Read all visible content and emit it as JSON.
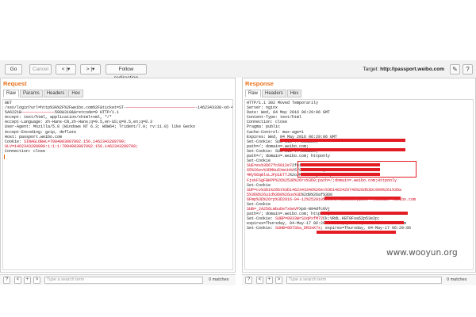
{
  "toolbar": {
    "go": "Go",
    "cancel": "Cancel",
    "back": "< |▾",
    "forward": "> |▾",
    "follow": "Follow redirection",
    "target_label": "Target:",
    "target_value": "http://passport.weibo.com"
  },
  "request": {
    "title": "Request",
    "tabs": [
      "Raw",
      "Params",
      "Headers",
      "Hex"
    ],
    "lines": [
      {
        "t": "GET",
        "red": ""
      },
      {
        "t": "/sso/login?url=http%3A%2F%2Fweibo.com%2F&ticket=ST-",
        "red": "—————————————————————————————",
        "tail": "-1462343338-xd-465642B"
      },
      {
        "t": "5A6221B",
        "red": "——————————————",
        "tail": "580&318&&retcode=0 HTTP/1.1"
      },
      {
        "t": "Accept: text/html, application/xhtml+xml, */*",
        "red": ""
      },
      {
        "t": "Accept-Language: zh-Hans-CN,zh-Hans;q=0.5,en-US;q=0.5,en;q=0.3",
        "red": ""
      },
      {
        "t": "User-Agent: Mozilla/5.0 (Windows NT 6.3; WOW64; Trident/7.0; rv:11.0) like Gecko",
        "red": ""
      },
      {
        "t": "Accept-Encoding: gzip, deflate",
        "red": ""
      },
      {
        "t": "Host: passport.weibo.com",
        "red": ""
      },
      {
        "t": "Cookie: ",
        "red": "SINAGLOBAL=7004083087092.156.1462343289799;"
      },
      {
        "t": "",
        "red": "ULV=1462343289800:1:1:1:7004083087092.156.1462343289799;"
      },
      {
        "t": "Connection: close",
        "red": ""
      }
    ]
  },
  "response": {
    "title": "Response",
    "tabs": [
      "Raw",
      "Headers",
      "Hex"
    ],
    "lines": [
      {
        "t": "HTTP/1.1 302 Moved Temporarily",
        "red": ""
      },
      {
        "t": "Server: nginx",
        "red": ""
      },
      {
        "t": "Date: Wed, 04 May 2016 06:29:06 GMT",
        "red": ""
      },
      {
        "t": "Content-Type: text/html",
        "red": ""
      },
      {
        "t": "Connection: close",
        "red": ""
      },
      {
        "t": "Pragma: public",
        "red": ""
      },
      {
        "t": "Cache-Control: max-age=1",
        "red": ""
      },
      {
        "t": "Expires: Wed, 04 May 2016 06:29:06 GMT",
        "red": ""
      },
      {
        "t": "Set-Cookie: SUS=SID-",
        "red": "",
        "tail": "7f403a1bc;"
      },
      {
        "t": "path=/; domain=.weibo.com;",
        "red": ""
      },
      {
        "t": "Set-Cookie: SUS=SID-",
        "red": "",
        "tail": "7f403a1bc;"
      },
      {
        "t": "path=/; domain=.weibo.com; httponly",
        "red": ""
      },
      {
        "t": "Set-Cookie",
        "red": ""
      },
      {
        "t": "",
        "red": "SUE=es%3D67fc6812e7",
        "tail": "2fe1985419c24aa3108c9087"
      },
      {
        "t": "",
        "red": "65%26ev%3DMHu5Xm1H4A",
        "tail": "5f9sadn5e17Ry8W7E8v%2b2"
      },
      {
        "t": "",
        "red": "4Ry%6qmlsLJFp1ETTJ",
        "tail": "%2oJMuDevLfy%4Blnp5%2SX"
      },
      {
        "t": "",
        "red": "FjskFSgFBKPP%26%253D%26rv%3D0;path=/;domain=.weibo.com;Httponly",
        "tail": ""
      },
      {
        "t": "Set-Cookie",
        "red": ""
      },
      {
        "t": "",
        "red": "SUP=cv%3D1%26bt%3D1462343346%26et%3D1462429746%26d%3Dc909%26i%3Da",
        "tail": ""
      },
      {
        "t": "",
        "red": "5%3D0%26uid%3D0%26us%3D",
        "tail": "%2d0%26af%3D0"
      },
      {
        "t": "",
        "red": "6Fmp%3D%26rp%3D2016-04-12%252010%253A57%253A25;path=/;domain=.weibo.com",
        "tail": ""
      },
      {
        "t": "Set-Cookie",
        "red": ""
      },
      {
        "t": "",
        "red": "SUB=_2A256LmbuDeTxGeVP",
        "tail": "Xp8-N94dfc8Vj"
      },
      {
        "t": "path=/; domain=.weibo.com; httponly",
        "red": ""
      },
      {
        "t": "Set-Cookie: ",
        "red": "SUBP=0033WrSXqPxfM72",
        "tail": "Ck;VRdL.KBT0Fsa5Zp53e2p;"
      },
      {
        "t": "expires=Thursday, 04-May-17 06:29:06 GMT; path=/; domain=.weibo.com",
        "red": ""
      },
      {
        "t": "Set-Cookie: ",
        "red": "SUHB=0D7Sba_DR3xK7s",
        "tail": "; expires=Thursday, 04-May-17 06:29:06"
      }
    ]
  },
  "search": {
    "placeholder": "Type a search term",
    "matches_left": "0 matches",
    "matches_right": "0 matches",
    "help": "?",
    "prev": "<",
    "add": "+",
    "next": ">"
  },
  "watermark": "www.wooyun.org",
  "colors": {
    "accent": "#e8711a",
    "redaction": "#e31b23"
  }
}
